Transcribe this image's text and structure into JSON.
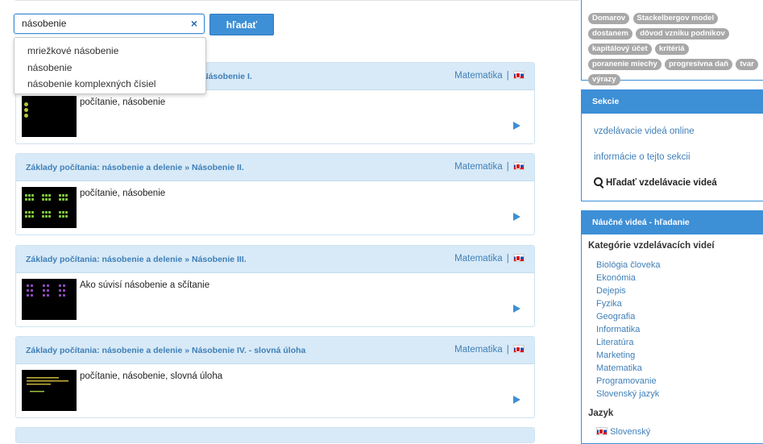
{
  "search": {
    "value": "násobenie",
    "clear_symbol": "×",
    "button_label": "hľadať",
    "suggestions": [
      "mriežkové násobenie",
      "násobenie",
      "násobenie komplexných čísiel"
    ]
  },
  "results": [
    {
      "title": "Základy počítania: násobenie a delenie » Násobenie I.",
      "title_visible": "Násobenie I.",
      "category": "Matematika",
      "separator": "|",
      "description": "počítanie, násobenie"
    },
    {
      "title": "Základy počítania: násobenie a delenie » Násobenie II.",
      "category": "Matematika",
      "separator": "|",
      "description": "počítanie, násobenie"
    },
    {
      "title": "Základy počítania: násobenie a delenie » Násobenie III.",
      "category": "Matematika",
      "separator": "|",
      "description": "Ako súvisí násobenie a sčítanie"
    },
    {
      "title": "Základy počítania: násobenie a delenie » Násobenie IV. - slovná úloha",
      "category": "Matematika",
      "separator": "|",
      "description": "počítanie, násobenie, slovná úloha"
    }
  ],
  "tags": [
    "Domarov",
    "Stackelbergov model",
    "dostanem",
    "dôvod vzniku podnikov",
    "kapitálový účet",
    "kritériá",
    "poranenie miechy",
    "progresívna daň",
    "tvar",
    "výrazy"
  ],
  "sekcie": {
    "title": "Sekcie",
    "links": [
      "vzdelávacie videá online",
      "informácie o tejto sekcii"
    ],
    "search_label": "Hľadať vzdelávacie videá"
  },
  "naucne": {
    "title": "Náučné videá - hľadanie",
    "categories_heading": "Kategórie vzdelávacích videí",
    "categories": [
      "Biológia človeka",
      "Ekonómia",
      "Dejepis",
      "Fyzika",
      "Geografia",
      "Informatika",
      "Literatúra",
      "Marketing",
      "Matematika",
      "Programovanie",
      "Slovenský jazyk"
    ],
    "language_heading": "Jazyk",
    "language_item": "Slovenský"
  },
  "colors": {
    "accent": "#3d8fd6",
    "link": "#3f7fb8",
    "card_header": "#d8eaf7",
    "tag": "#a8a8a8"
  }
}
